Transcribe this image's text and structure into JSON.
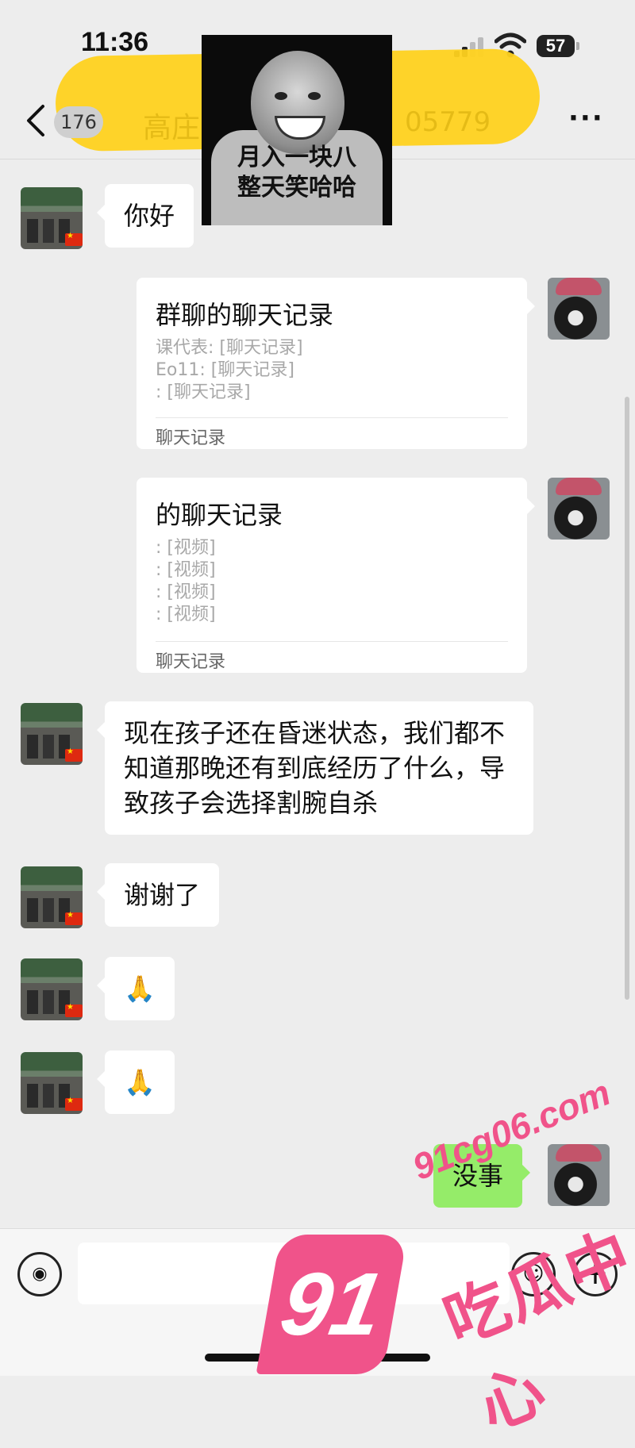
{
  "status": {
    "time": "11:36",
    "battery": "57"
  },
  "header": {
    "back_badge": "176",
    "title": "高庄",
    "title_suffix": "05779",
    "more": "···"
  },
  "sticker": {
    "line1": "月入一块八",
    "line2": "整天笑哈哈"
  },
  "messages": {
    "m1": "你好",
    "card1": {
      "title": "群聊的聊天记录",
      "lines": [
        "课代表: [聊天记录]",
        "Eo11: [聊天记录]",
        ": [聊天记录]"
      ],
      "footer": "聊天记录"
    },
    "card2": {
      "title": "的聊天记录",
      "lines": [
        ": [视频]",
        ": [视频]",
        ": [视频]",
        ": [视频]"
      ],
      "footer": "聊天记录"
    },
    "m2": "现在孩子还在昏迷状态，我们都不知道那晚还有到底经历了什么，导致孩子会选择割腕自杀",
    "m3": "谢谢了",
    "m4": "🙏",
    "m5": "🙏",
    "m6": "没事"
  },
  "input": {
    "placeholder": ""
  },
  "watermark": {
    "logo": "91",
    "site": "91cg06.com",
    "name": "吃瓜中心"
  },
  "colors": {
    "background": "#ededed",
    "sent_bubble": "#95ec69",
    "highlight": "#ffd21f",
    "watermark": "#f0538a"
  }
}
